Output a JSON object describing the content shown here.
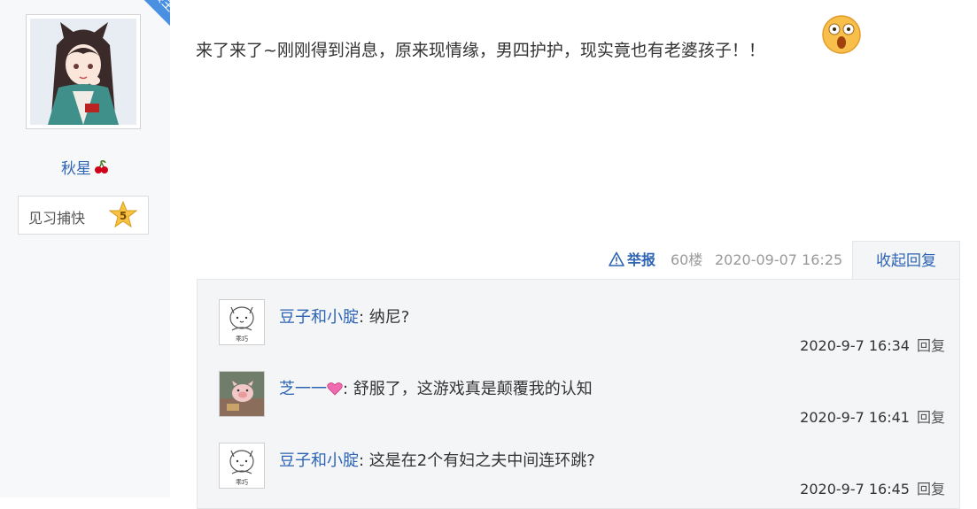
{
  "author": {
    "badge": "楼主",
    "name": "秋星",
    "level_title": "见习捕快",
    "level_num": "5"
  },
  "post": {
    "content": "来了来了~刚刚得到消息，原来现情缘，男四护护，现实竟也有老婆孩子！！",
    "report_label": "举报",
    "floor": "60楼",
    "time": "2020-09-07 16:25",
    "collapse_label": "收起回复"
  },
  "replies": [
    {
      "user": "豆子和小腚",
      "sep": ": ",
      "text": "纳尼?",
      "time": "2020-9-7 16:34",
      "reply_label": "回复",
      "avatar_caption": "乖巧"
    },
    {
      "user": "芝一一",
      "sep": ": ",
      "text": "舒服了，这游戏真是颠覆我的认知",
      "time": "2020-9-7 16:41",
      "reply_label": "回复"
    },
    {
      "user": "豆子和小腚",
      "sep": ": ",
      "text": "这是在2个有妇之夫中间连环跳?",
      "time": "2020-9-7 16:45",
      "reply_label": "回复",
      "avatar_caption": "乖巧"
    }
  ],
  "colors": {
    "link": "#2d64b3",
    "ribbon": "#4a90e2",
    "panel": "#f4f5f7"
  },
  "icons": [
    "cherry-icon",
    "level-star-icon",
    "surprised-emoji-icon",
    "warning-icon",
    "heart-icon"
  ]
}
